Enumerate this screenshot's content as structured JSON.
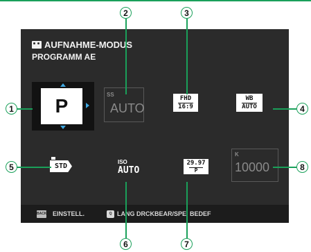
{
  "header": {
    "title": "AUFNAHME-MODUS",
    "subtitle": "PROGRAMM AE",
    "title_icon": "movie-camera-icon"
  },
  "tiles": {
    "mode": {
      "value": "P"
    },
    "shutter": {
      "label": "SS",
      "value": "AUTO"
    },
    "movie_mode": {
      "line1": "FHD",
      "line2": "16:9"
    },
    "white_balance": {
      "line1": "WB",
      "line2": "AUTO"
    },
    "film_simulation": {
      "value": "STD"
    },
    "iso": {
      "label": "ISO",
      "value": "AUTO"
    },
    "frame_rate": {
      "line1": "29.97",
      "line2": "P"
    },
    "kelvin": {
      "label": "K",
      "value": "10000"
    }
  },
  "footer": {
    "back_key": "BACK",
    "back_label": "EINSTELL.",
    "q_key": "Q",
    "q_label": "LANG DRCKBEAR/SPEI BEDEF"
  },
  "callouts": [
    "1",
    "2",
    "3",
    "4",
    "5",
    "6",
    "7",
    "8"
  ],
  "colors": {
    "accent": "#1aa05a",
    "selector": "#3fa7e0",
    "screen": "#2b2b2b"
  }
}
